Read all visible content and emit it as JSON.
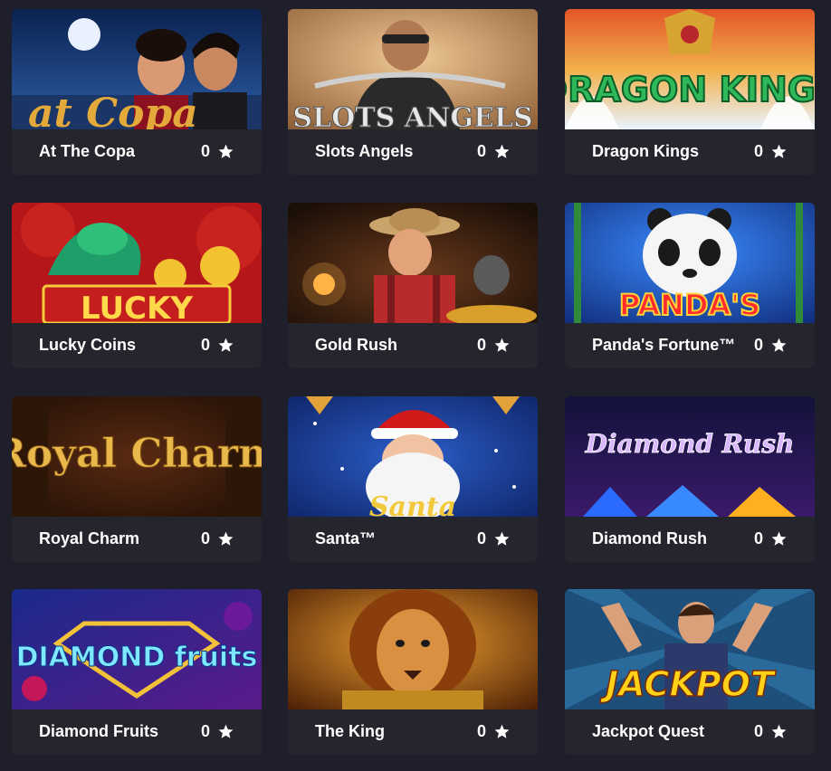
{
  "games": [
    {
      "title": "At The Copa",
      "rating": "0",
      "art_text": "at Copa",
      "art": "copa-artwork"
    },
    {
      "title": "Slots Angels",
      "rating": "0",
      "art_text": "SLOTS ANGELS",
      "art": "biker-artwork"
    },
    {
      "title": "Dragon Kings",
      "rating": "0",
      "art_text": "DRAGON KINGS",
      "art": "dragon-artwork"
    },
    {
      "title": "Lucky Coins",
      "rating": "0",
      "art_text": "LUCKY",
      "art": "lucky-dragon-artwork"
    },
    {
      "title": "Gold Rush",
      "rating": "0",
      "art_text": "",
      "art": "gold-miner-artwork"
    },
    {
      "title": "Panda's Fortune™",
      "rating": "0",
      "art_text": "PANDA'S",
      "art": "panda-artwork"
    },
    {
      "title": "Royal Charm",
      "rating": "0",
      "art_text": "Royal Charm",
      "art": "royal-charm-artwork"
    },
    {
      "title": "Santa™",
      "rating": "0",
      "art_text": "Santa",
      "art": "santa-artwork"
    },
    {
      "title": "Diamond Rush",
      "rating": "0",
      "art_text": "Diamond Rush",
      "art": "diamond-rush-artwork"
    },
    {
      "title": "Diamond Fruits",
      "rating": "0",
      "art_text": "DIAMOND fruits",
      "art": "diamond-fruits-artwork"
    },
    {
      "title": "The King",
      "rating": "0",
      "art_text": "",
      "art": "lion-artwork"
    },
    {
      "title": "Jackpot Quest",
      "rating": "0",
      "art_text": "JACKPOT",
      "art": "jackpot-artwork"
    }
  ],
  "colors": {
    "page_bg": "#1f1f2b",
    "card_footer": "#25262f",
    "text": "#ffffff"
  }
}
